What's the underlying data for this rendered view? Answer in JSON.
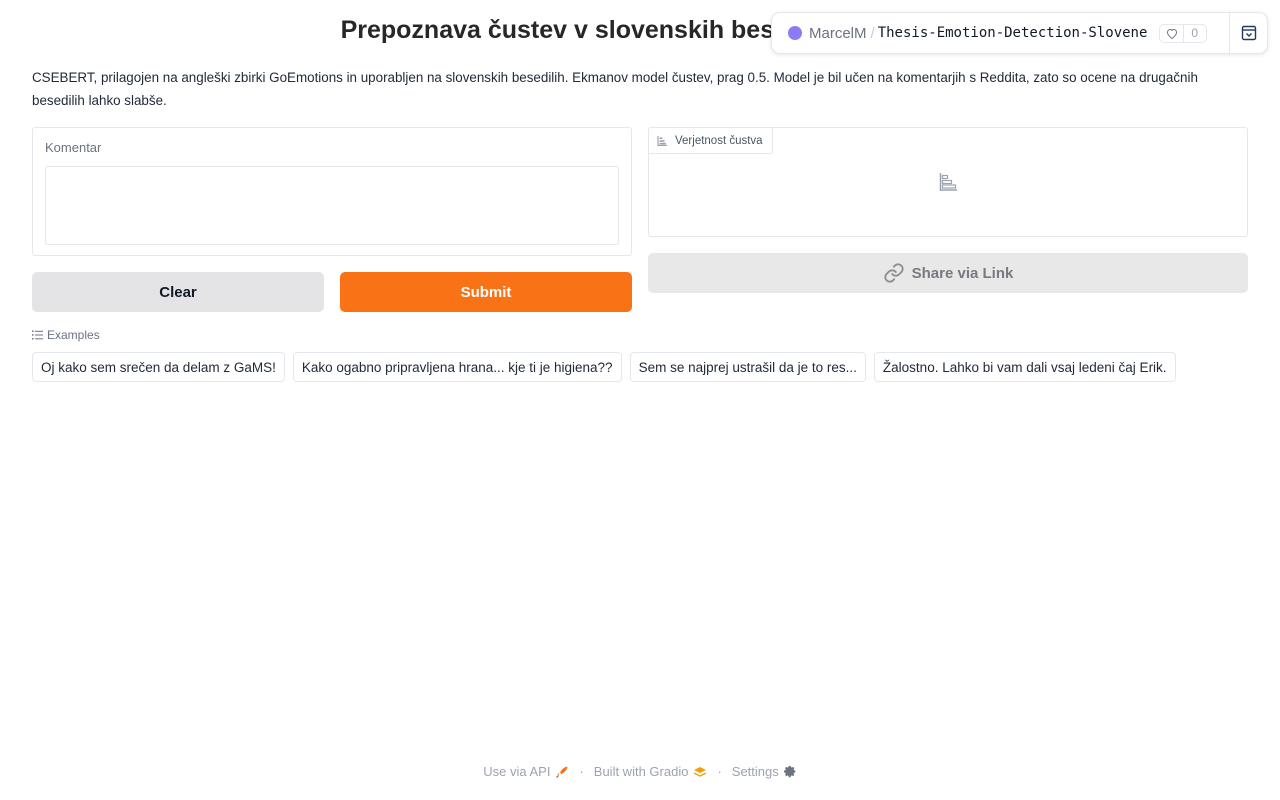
{
  "title": "Prepoznava čustev v slovenskih besedilih",
  "space": {
    "owner": "MarcelM",
    "separator": "/",
    "repo": "Thesis-Emotion-Detection-Slovene",
    "likes": "0"
  },
  "description": "CSEBERT, prilagojen na angleški zbirki GoEmotions in uporabljen na slovenskih besedilih. Ekmanov model čustev, prag 0.5. Model je bil učen na komentarjih s Reddita, zato so ocene na drugačnih besedilih lahko slabše.",
  "input": {
    "label": "Komentar",
    "value": "",
    "placeholder": ""
  },
  "buttons": {
    "clear": "Clear",
    "submit": "Submit",
    "share": "Share via Link"
  },
  "output": {
    "label": "Verjetnost čustva"
  },
  "examples": {
    "label": "Examples",
    "items": [
      "Oj kako sem srečen da delam z GaMS!",
      "Kako ogabno pripravljena hrana... kje ti je higiena??",
      "Sem se najprej ustrašil da je to res...",
      "Žalostno. Lahko bi vam dali vsaj ledeni čaj Erik."
    ]
  },
  "footer": {
    "api": "Use via API",
    "built": "Built with Gradio",
    "settings": "Settings",
    "dot": "·"
  },
  "colors": {
    "accent": "#f97316",
    "avatar": "#8b7cf6"
  }
}
